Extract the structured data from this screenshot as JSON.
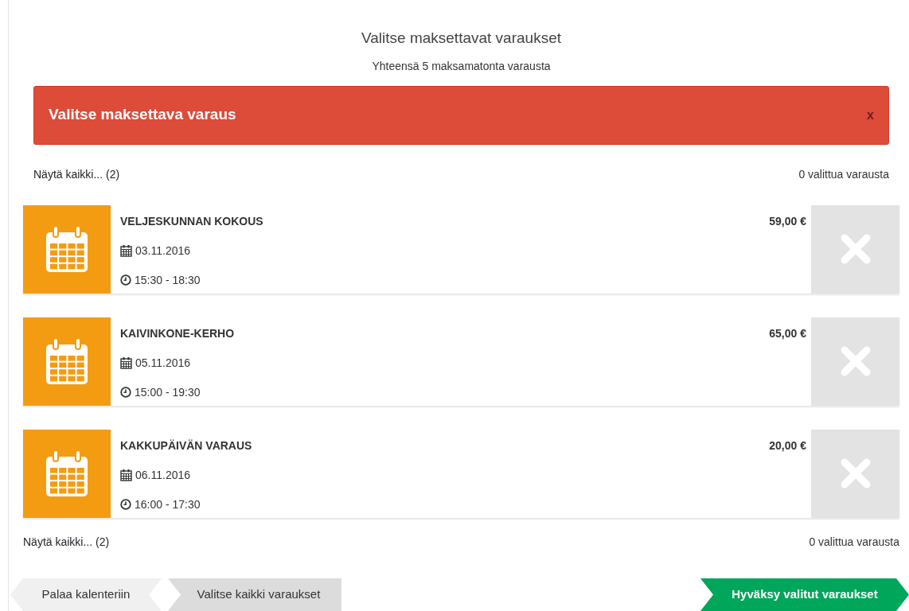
{
  "header": {
    "title": "Valitse maksettavat varaukset",
    "subtitle": "Yhteensä 5 maksamatonta varausta"
  },
  "alert": {
    "message": "Valitse maksettava varaus",
    "close": "x"
  },
  "summary_top": {
    "show_all": "Näytä kaikki... (2)",
    "selected_count": "0 valittua varausta"
  },
  "bookings": [
    {
      "name": "VELJESKUNNAN KOKOUS",
      "date": "03.11.2016",
      "time": "15:30 - 18:30",
      "price": "59,00 €",
      "selected": false
    },
    {
      "name": "KAIVINKONE-KERHO",
      "date": "05.11.2016",
      "time": "15:00 - 19:30",
      "price": "65,00 €",
      "selected": false
    },
    {
      "name": "KAKKUPÄIVÄN VARAUS",
      "date": "06.11.2016",
      "time": "16:00 - 17:30",
      "price": "20,00 €",
      "selected": false
    }
  ],
  "summary_bottom": {
    "show_all": "Näytä kaikki... (2)",
    "selected_count": "0 valittua varausta"
  },
  "buttons": [
    {
      "label": "Palaa kalenteriin",
      "kind": "back"
    },
    {
      "label": "Valitse kaikki varaukset",
      "kind": "select"
    },
    {
      "label": "Hyväksy valitut varaukset",
      "kind": "confirm"
    }
  ]
}
